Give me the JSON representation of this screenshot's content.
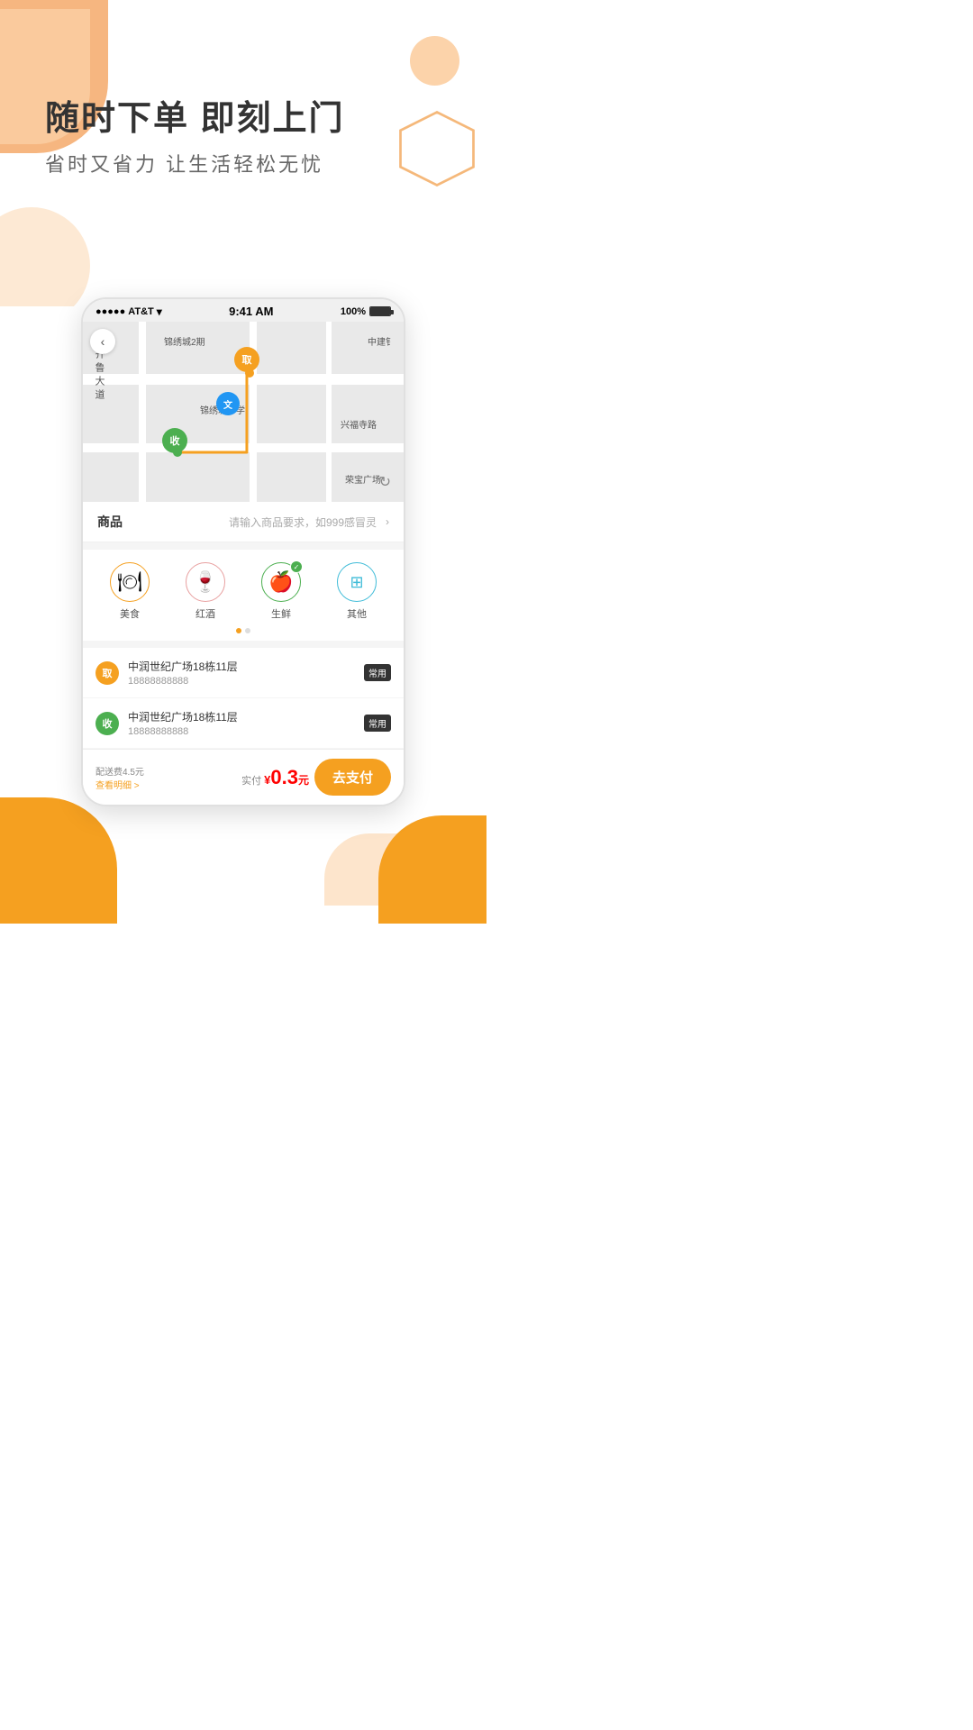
{
  "hero": {
    "title": "随时下单 即刻上门",
    "subtitle": "省时又省力   让生活轻松无忧"
  },
  "statusBar": {
    "carrier": "AT&T",
    "time": "9:41 AM",
    "battery": "100%"
  },
  "map": {
    "backButton": "‹",
    "label_school": "锦绣城小学",
    "label_area": "锦绣城2期",
    "label_road1": "中建钅",
    "label_street1": "兴福寺路",
    "label_rong": "荣宝广场",
    "label_qilu": "齐鲁大道",
    "pin_qu": "取",
    "pin_shou": "收",
    "pin_wen": "文"
  },
  "goods": {
    "label": "商品",
    "placeholder": "请输入商品要求，如999感冒灵"
  },
  "categories": [
    {
      "name": "美食",
      "emoji": "🍽",
      "checked": false
    },
    {
      "name": "红酒",
      "emoji": "🍷",
      "checked": false
    },
    {
      "name": "生鲜",
      "emoji": "🍎",
      "checked": true
    },
    {
      "name": "其他",
      "emoji": "⊞",
      "checked": false
    }
  ],
  "addresses": [
    {
      "type": "qu",
      "typeLabel": "取",
      "name": "中润世纪广场18栋11层",
      "phone": "18888888888",
      "tag": "常用"
    },
    {
      "type": "shou",
      "typeLabel": "收",
      "name": "中润世纪广场18栋11层",
      "phone": "18888888888",
      "tag": "常用"
    }
  ],
  "bottomBar": {
    "feeLabel": "配送费4.5元",
    "feeDetail": "查看明细 >",
    "totalLabel": "实付",
    "currencySymbol": "¥",
    "price": "0.3",
    "priceUnit": "元",
    "payButton": "去支付"
  }
}
